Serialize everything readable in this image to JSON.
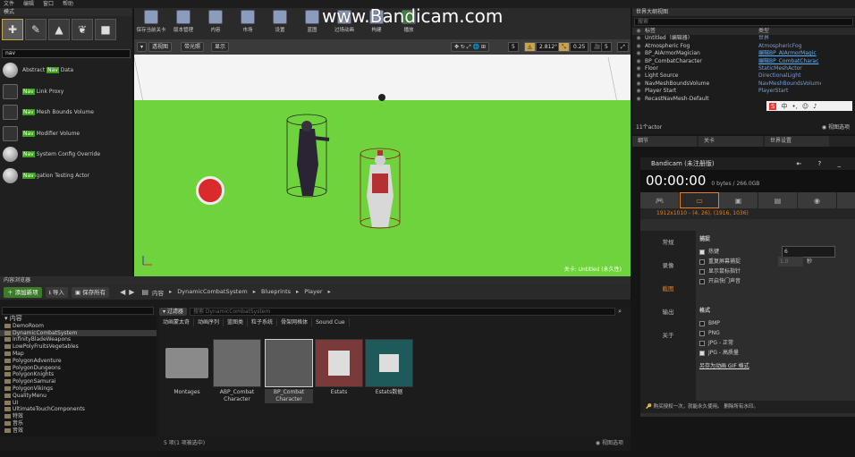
{
  "menubar": [
    "文件",
    "编辑",
    "窗口",
    "帮助"
  ],
  "mode_panel": {
    "tab": "模式",
    "search": "nav",
    "items": [
      {
        "pre": "Abstract ",
        "hl": "Nav",
        "post": " Data"
      },
      {
        "pre": "",
        "hl": "Nav",
        "post": " Link Proxy"
      },
      {
        "pre": "",
        "hl": "Nav",
        "post": " Mesh Bounds Volume"
      },
      {
        "pre": "",
        "hl": "Nav",
        "post": " Modifier Volume"
      },
      {
        "pre": "",
        "hl": "Nav",
        "post": " System Config Override"
      },
      {
        "pre": "",
        "hl": "Nav",
        "post": "igation Testing Actor"
      }
    ]
  },
  "toolbar": {
    "buttons": [
      "保存当前关卡",
      "版本管理",
      "内容",
      "市场",
      "设置",
      "蓝图",
      "过场动画",
      "构建",
      "播放"
    ]
  },
  "viewport": {
    "perspective": "透视图",
    "lit": "带光照",
    "show": "显示",
    "snap1": "5",
    "angle": "2.812°",
    "scale": "0.25",
    "snap2": "5",
    "caption": "关卡: Untitled (永久性)"
  },
  "watermark": "www.Bandicam.com",
  "content_browser": {
    "tab": "内容浏览器",
    "add_new": "添加新项",
    "import": "导入",
    "save_all": "保存所有",
    "path": [
      "内容",
      "DynamicCombatSystem",
      "Blueprints",
      "Player"
    ],
    "filter_label": "过滤器",
    "search_placeholder": "搜索 DynamicCombatSystem",
    "filters": [
      "动画蒙太奇",
      "动画序列",
      "蓝图类",
      "粒子系统",
      "骨架网格体",
      "Sound Cue"
    ],
    "tree_root": "内容",
    "tree": [
      "DemoRoom",
      "DynamicCombatSystem",
      "InfinityBladeWeapons",
      "LowPolyFruitsVegetables",
      "Map",
      "PolygonAdventure",
      "PolygonDungeons",
      "PolygonKnights",
      "PolygonSamurai",
      "PolygonVikings",
      "QualityMenu",
      "UI",
      "UltimateTouchComponents",
      "特效",
      "音乐",
      "音效"
    ],
    "assets": [
      "Montages",
      "ABP_Combat\nCharacter",
      "BP_Combat\nCharacter",
      "Estats",
      "Estats数据"
    ],
    "status": "5 项(1 项被选中)",
    "view_options": "视图选项"
  },
  "outliner": {
    "tab1": "世界大纲视图",
    "search_placeholder": "搜索",
    "col_label": "标签",
    "col_type": "类型",
    "rows": [
      {
        "name": "Untitled（编辑器）",
        "type": "世界"
      },
      {
        "name": "Atmospheric Fog",
        "type": "AtmosphericFog"
      },
      {
        "name": "BP_AIArmorMagician",
        "type": "编辑BP_AIArmorMagic"
      },
      {
        "name": "BP_CombatCharacter",
        "type": "编辑BP_CombatCharac"
      },
      {
        "name": "Floor",
        "type": "StaticMeshActor"
      },
      {
        "name": "Light Source",
        "type": "DirectionalLight"
      },
      {
        "name": "NavMeshBoundsVolume",
        "type": "NavMeshBoundsVolume"
      },
      {
        "name": "Player Start",
        "type": "PlayerStart"
      },
      {
        "name": "RecastNavMesh-Default",
        "type": ""
      }
    ],
    "count": "11个actor",
    "view_options": "视图选项"
  },
  "details_tabs": [
    "细节",
    "关卡",
    "世界设置"
  ],
  "bandicam": {
    "title": "Bandicam (未注册版)",
    "time": "00:00:00",
    "size": "0 bytes / 266.0GB",
    "resolution": "1912x1010 - (4, 26), (1916, 1036)",
    "side": [
      "常规",
      "录像",
      "截图",
      "输出",
      "关于"
    ],
    "section1": "捕捉",
    "hotkey_label": "热键",
    "hotkey_value": "6",
    "repeat_label": "重复屏幕捕捉",
    "repeat_value": "1.0",
    "repeat_unit": "秒",
    "cursor_label": "显示鼠标指针",
    "sound_label": "开启快门声音",
    "section2": "格式",
    "formats": [
      "BMP",
      "PNG",
      "JPG - 正常",
      "JPG - 高质量"
    ],
    "gif_link": "另存为动画 GIF 格式",
    "footer": "购买授权一次，就能永久使用。 删除所有水印。"
  }
}
